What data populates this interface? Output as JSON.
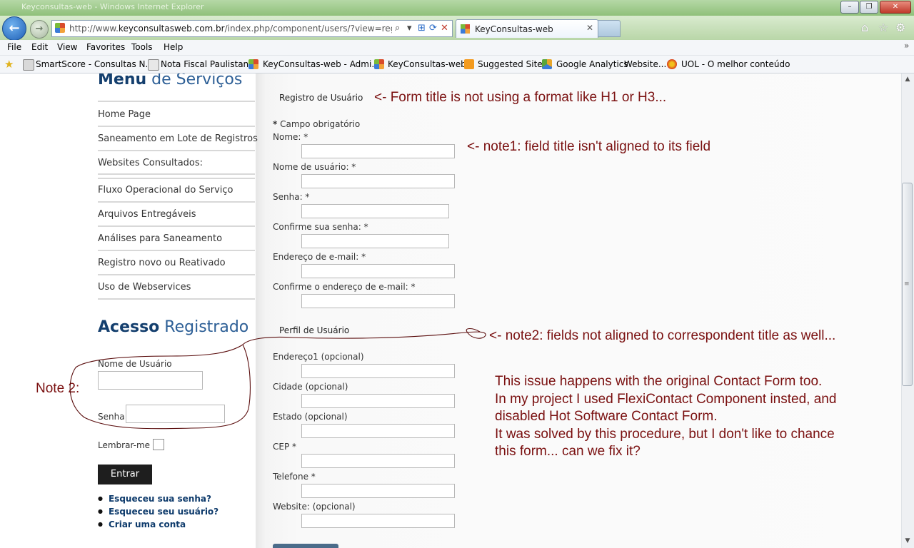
{
  "window": {
    "title": "Keyconsultas-web - Windows Internet Explorer",
    "buttons": {
      "minimize": "–",
      "maximize": "❐",
      "close": "✕"
    }
  },
  "nav": {
    "back_icon": "back-arrow-icon",
    "forward_icon": "forward-arrow-icon",
    "address": {
      "url_prefix": "http://www.",
      "url_domain": "keyconsultasweb.com.br",
      "url_rest": "/index.php/component/users/?view=registratior",
      "icons": {
        "search": "⌕",
        "dropdown": "▾",
        "compat": "⊞",
        "refresh": "⟳",
        "stop": "✕"
      }
    },
    "tab": {
      "label": "KeyConsultas-web",
      "close": "✕"
    },
    "right_icons": {
      "home": "⌂",
      "favorites": "☆",
      "tools": "⚙"
    }
  },
  "menu": [
    "File",
    "Edit",
    "View",
    "Favorites",
    "Tools",
    "Help"
  ],
  "favorites_bar": [
    "SmartScore - Consultas N...",
    "Nota Fiscal Paulistana",
    "KeyConsultas-web - Admi...",
    "KeyConsultas-web",
    "Suggested Sites",
    "Google Analytics",
    "Website...",
    "UOL - O melhor conteúdo"
  ],
  "sidebar": {
    "menu_heading_bold": "Menu",
    "menu_heading_rest": "de Serviços",
    "links": [
      "Home Page",
      "Saneamento em Lote de Registros",
      "Websites Consultados:",
      "Fluxo Operacional do Serviço",
      "Arquivos Entregáveis",
      "Análises para Saneamento",
      "Registro novo ou Reativado",
      "Uso de Webservices"
    ],
    "login_heading_bold": "Acesso",
    "login_heading_rest": "Registrado",
    "username_label": "Nome de Usuário",
    "password_label": "Senha",
    "remember_label": "Lembrar-me",
    "login_button": "Entrar",
    "bullets": [
      "Esqueceu sua senha?",
      "Esqueceu seu usuário?",
      "Criar uma conta"
    ]
  },
  "form": {
    "legend1": "Registro de Usuário",
    "required_star": "*",
    "required_text": "Campo obrigatório",
    "fields1": [
      "Nome: *",
      "Nome de usuário: *",
      "Senha: *",
      "Confirme sua senha: *",
      "Endereço de e-mail: *",
      "Confirme o endereço de e-mail: *"
    ],
    "legend2": "Perfil de Usuário",
    "fields2": [
      "Endereço1 (opcional)",
      "Cidade (opcional)",
      "Estado (opcional)",
      "CEP *",
      "Telefone *",
      "Website: (opcional)"
    ]
  },
  "annotations": {
    "title_note": "<- Form title is not using a format like H1 or H3...",
    "note1": "<- note1: field title isn't aligned to its field",
    "note2": "<- note2: fields not aligned to correspondent title as well...",
    "note2_side": "Note 2:",
    "paragraph": [
      "This issue happens with the original Contact Form too.",
      "In my project I used FlexiContact Component insted, and",
      "disabled Hot Software Contact Form.",
      "It was solved by this procedure, but I don't like to chance",
      "this form... can we fix it?"
    ],
    "ink_color": "#7a1010"
  },
  "scrollbar": {
    "up": "▲",
    "down": "▼",
    "grip": "≡"
  }
}
